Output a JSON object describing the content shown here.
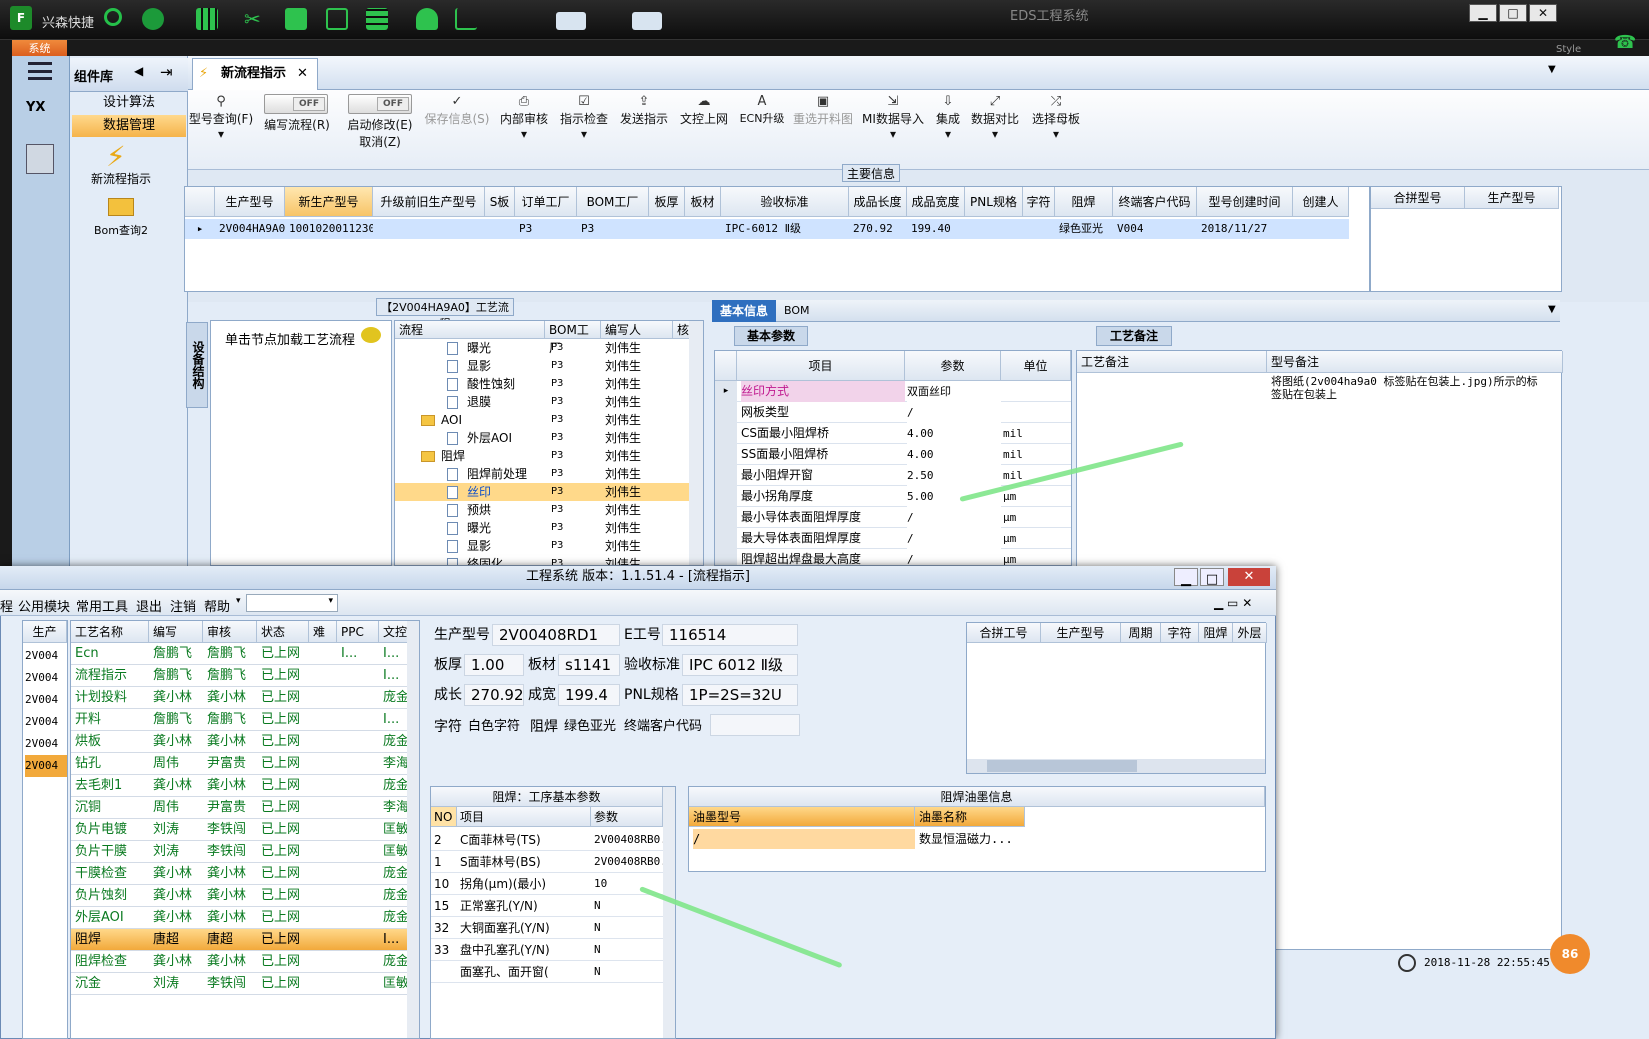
{
  "topbar": {
    "app_left": "兴森快捷",
    "title": "EDS工程系统",
    "style": "Style",
    "system_btn": "系统"
  },
  "nav": {
    "header": "组件库",
    "items": [
      "设计算法",
      "数据管理"
    ],
    "big": [
      "新流程指示",
      "Bom查询2"
    ],
    "yx": "YX"
  },
  "tab": {
    "label": "新流程指示"
  },
  "ribbon": {
    "items": [
      "型号查询(F)",
      "编写流程(R)",
      "启动修改(E)",
      "保存信息(S)",
      "内部审核",
      "指示检查",
      "发送指示",
      "文控上网",
      "ECN升级",
      "重选开料图",
      "MI数据导入",
      "集成",
      "数据对比",
      "选择母板"
    ],
    "toggle": "OFF",
    "cancel": "取消(Z)"
  },
  "main_info": {
    "title": "主要信息",
    "headers": [
      "生产型号",
      "新生产型号",
      "升级前旧生产型号",
      "S板",
      "订单工厂",
      "BOM工厂",
      "板厚",
      "板材",
      "验收标准",
      "成品长度",
      "成品宽度",
      "PNL规格",
      "字符",
      "阻焊",
      "终端客户代码",
      "型号创建时间",
      "创建人"
    ],
    "row": [
      "2V004HA9A0",
      "10010200112303",
      "",
      "",
      "P3",
      "P3",
      "",
      "",
      "IPC-6012 Ⅱ级",
      "270.92",
      "199.40",
      "",
      "",
      "绿色亚光",
      "V004",
      "2018/11/27",
      ""
    ],
    "right_headers": [
      "合拼型号",
      "生产型号"
    ]
  },
  "process": {
    "title": "【2V004HA9A0】工艺流程",
    "side_tab": "设备结构",
    "hint": "单击节点加载工艺流程",
    "headers": [
      "流程",
      "BOM工厂",
      "编写人",
      "核"
    ],
    "rows": [
      [
        "曝光",
        "P3",
        "刘伟生",
        2,
        "doc"
      ],
      [
        "显影",
        "P3",
        "刘伟生",
        2,
        "doc"
      ],
      [
        "酸性蚀刻",
        "P3",
        "刘伟生",
        2,
        "doc"
      ],
      [
        "退膜",
        "P3",
        "刘伟生",
        2,
        "doc"
      ],
      [
        "AOI",
        "P3",
        "刘伟生",
        1,
        "fold"
      ],
      [
        "外层AOI",
        "P3",
        "刘伟生",
        2,
        "doc"
      ],
      [
        "阻焊",
        "P3",
        "刘伟生",
        1,
        "fold"
      ],
      [
        "阻焊前处理",
        "P3",
        "刘伟生",
        2,
        "doc"
      ],
      [
        "丝印",
        "P3",
        "刘伟生",
        2,
        "doc"
      ],
      [
        "预烘",
        "P3",
        "刘伟生",
        2,
        "doc"
      ],
      [
        "曝光",
        "P3",
        "刘伟生",
        2,
        "doc"
      ],
      [
        "显影",
        "P3",
        "刘伟生",
        2,
        "doc"
      ],
      [
        "终固化",
        "P3",
        "刘伟生",
        2,
        "doc"
      ]
    ]
  },
  "basic": {
    "tabs": [
      "基本信息",
      "BOM"
    ],
    "section": "基本参数",
    "headers": [
      "项目",
      "参数",
      "单位"
    ],
    "rows": [
      [
        "丝印方式",
        "双面丝印",
        ""
      ],
      [
        "网板类型",
        "/",
        ""
      ],
      [
        "CS面最小阻焊桥",
        "4.00",
        "mil"
      ],
      [
        "SS面最小阻焊桥",
        "4.00",
        "mil"
      ],
      [
        "最小阻焊开窗",
        "2.50",
        "mil"
      ],
      [
        "最小拐角厚度",
        "5.00",
        "μm"
      ],
      [
        "最小导体表面阻焊厚度",
        "/",
        "μm"
      ],
      [
        "最大导体表面阻焊厚度",
        "/",
        "μm"
      ],
      [
        "阻焊超出焊盘最大高度",
        "/",
        "μm"
      ]
    ]
  },
  "remark": {
    "section": "工艺备注",
    "col1": "工艺备注",
    "col2": "型号备注",
    "text": "将图纸(2v004ha9a0 标签贴在包装上.jpg)所示的标签贴在包装上"
  },
  "status": {
    "time": "2018-11-28 22:55:45",
    "badge": "86"
  },
  "win2": {
    "title": "工程系统  版本：1.1.51.4 - [流程指示]",
    "menu": [
      "程",
      "公用模块",
      "常用工具",
      "退出",
      "注销",
      "帮助"
    ],
    "left_col": "生产",
    "left_rows": [
      "2V004",
      "2V004",
      "2V004",
      "2V004",
      "2V004",
      "2V004"
    ],
    "list_headers": [
      "工艺名称",
      "编写",
      "审核",
      "状态",
      "难",
      "PPC",
      "文控"
    ],
    "list_rows": [
      [
        "Ecn",
        "詹鹏飞",
        "詹鹏飞",
        "已上网",
        "",
        "I...",
        "I..."
      ],
      [
        "流程指示",
        "詹鹏飞",
        "詹鹏飞",
        "已上网",
        "",
        "",
        "I..."
      ],
      [
        "计划投料",
        "龚小林",
        "龚小林",
        "已上网",
        "",
        "",
        "庞金"
      ],
      [
        "开料",
        "詹鹏飞",
        "詹鹏飞",
        "已上网",
        "",
        "",
        "I..."
      ],
      [
        "烘板",
        "龚小林",
        "龚小林",
        "已上网",
        "",
        "",
        "庞金"
      ],
      [
        "钻孔",
        "周伟",
        "尹富贵",
        "已上网",
        "",
        "",
        "李海"
      ],
      [
        "去毛刺1",
        "龚小林",
        "龚小林",
        "已上网",
        "",
        "",
        "庞金"
      ],
      [
        "沉铜",
        "周伟",
        "尹富贵",
        "已上网",
        "",
        "",
        "李海"
      ],
      [
        "负片电镀",
        "刘涛",
        "李铁闯",
        "已上网",
        "",
        "",
        "匡敏"
      ],
      [
        "负片干膜",
        "刘涛",
        "李铁闯",
        "已上网",
        "",
        "",
        "匡敏"
      ],
      [
        "干膜检查",
        "龚小林",
        "龚小林",
        "已上网",
        "",
        "",
        "庞金"
      ],
      [
        "负片蚀刻",
        "龚小林",
        "龚小林",
        "已上网",
        "",
        "",
        "庞金"
      ],
      [
        "外层AOI",
        "龚小林",
        "龚小林",
        "已上网",
        "",
        "",
        "庞金"
      ],
      [
        "阻焊",
        "唐超",
        "唐超",
        "已上网",
        "",
        "",
        "I..."
      ],
      [
        "阻焊检查",
        "龚小林",
        "龚小林",
        "已上网",
        "",
        "",
        "庞金"
      ],
      [
        "沉金",
        "刘涛",
        "李铁闯",
        "已上网",
        "",
        "",
        "匡敏"
      ]
    ],
    "fields": {
      "model_l": "生产型号",
      "model": "2V00408RD1",
      "e_l": "E工号",
      "e": "116514",
      "thick_l": "板厚",
      "thick": "1.00",
      "mat_l": "板材",
      "mat": "s1141",
      "std_l": "验收标准",
      "std": "IPC 6012 Ⅱ级",
      "len_l": "成长",
      "len": "270.92",
      "wid_l": "成宽",
      "wid": "199.4",
      "pnl_l": "PNL规格",
      "pnl": "1P=2S=32U",
      "char_l": "字符",
      "char": "白色字符",
      "sm_l": "阻焊",
      "sm": "绿色亚光",
      "cust_l": "终端客户代码",
      "cust": ""
    },
    "right_headers": [
      "合拼工号",
      "生产型号",
      "周期",
      "字符",
      "阻焊",
      "外层"
    ],
    "zh": {
      "title": "阻焊：工序基本参数",
      "headers": [
        "NO",
        "项目",
        "参数"
      ],
      "rows": [
        [
          "2",
          "C面菲林号(TS)",
          "2V00408RB0."
        ],
        [
          "1",
          "S面菲林号(BS)",
          "2V00408RB0."
        ],
        [
          "10",
          "拐角(μm)(最小)",
          "10"
        ],
        [
          "15",
          "正常塞孔(Y/N)",
          "N"
        ],
        [
          "32",
          "大铜面塞孔(Y/N)",
          "N"
        ],
        [
          "33",
          "盘中孔塞孔(Y/N)",
          "N"
        ],
        [
          "",
          "面塞孔、面开窗(",
          "N"
        ]
      ]
    },
    "ink": {
      "title": "阻焊油墨信息",
      "headers": [
        "油墨型号",
        "油墨名称"
      ],
      "row": [
        "/",
        "数显恒温磁力..."
      ]
    }
  }
}
